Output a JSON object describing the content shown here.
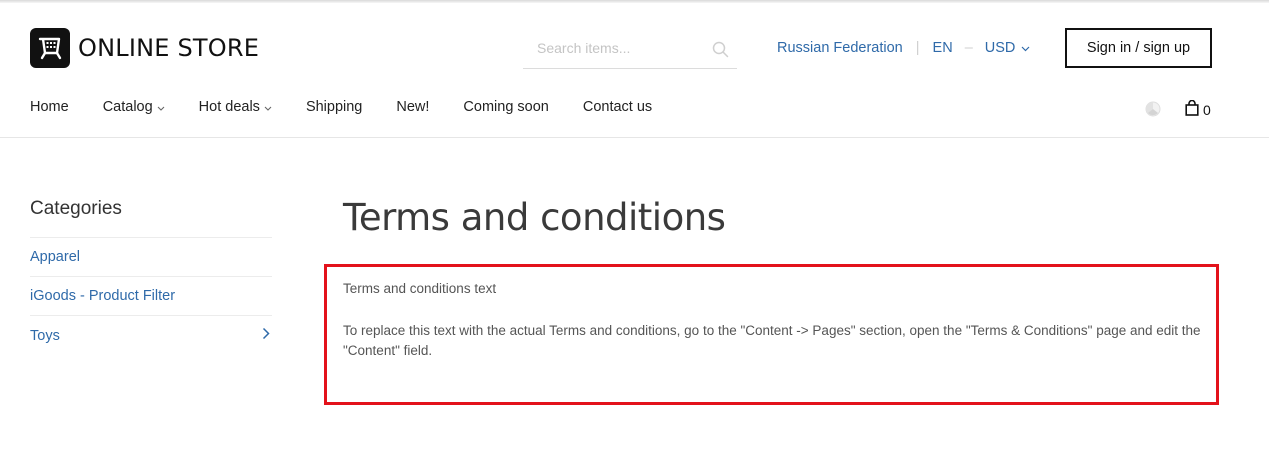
{
  "header": {
    "logo_text": "ONLINE STORE",
    "search_placeholder": "Search items...",
    "country": "Russian Federation",
    "language": "EN",
    "currency": "USD",
    "signin_label": "Sign in / sign up",
    "cart_count": "0"
  },
  "nav": {
    "items": [
      {
        "label": "Home",
        "has_dropdown": false
      },
      {
        "label": "Catalog",
        "has_dropdown": true
      },
      {
        "label": "Hot deals",
        "has_dropdown": true
      },
      {
        "label": "Shipping",
        "has_dropdown": false
      },
      {
        "label": "New!",
        "has_dropdown": false
      },
      {
        "label": "Coming soon",
        "has_dropdown": false
      },
      {
        "label": "Contact us",
        "has_dropdown": false
      }
    ]
  },
  "sidebar": {
    "title": "Categories",
    "items": [
      {
        "label": "Apparel"
      },
      {
        "label": "iGoods - Product Filter"
      },
      {
        "label": "Toys"
      }
    ]
  },
  "main": {
    "title": "Terms and conditions",
    "paragraph1": "Terms and conditions text",
    "paragraph2": "To replace this text with the actual Terms and conditions, go to the \"Content -> Pages\" section, open the \"Terms & Conditions\" page and edit the \"Content\" field."
  },
  "colors": {
    "link": "#2f6aa9",
    "highlight_border": "#e3121b",
    "text": "#222222"
  }
}
